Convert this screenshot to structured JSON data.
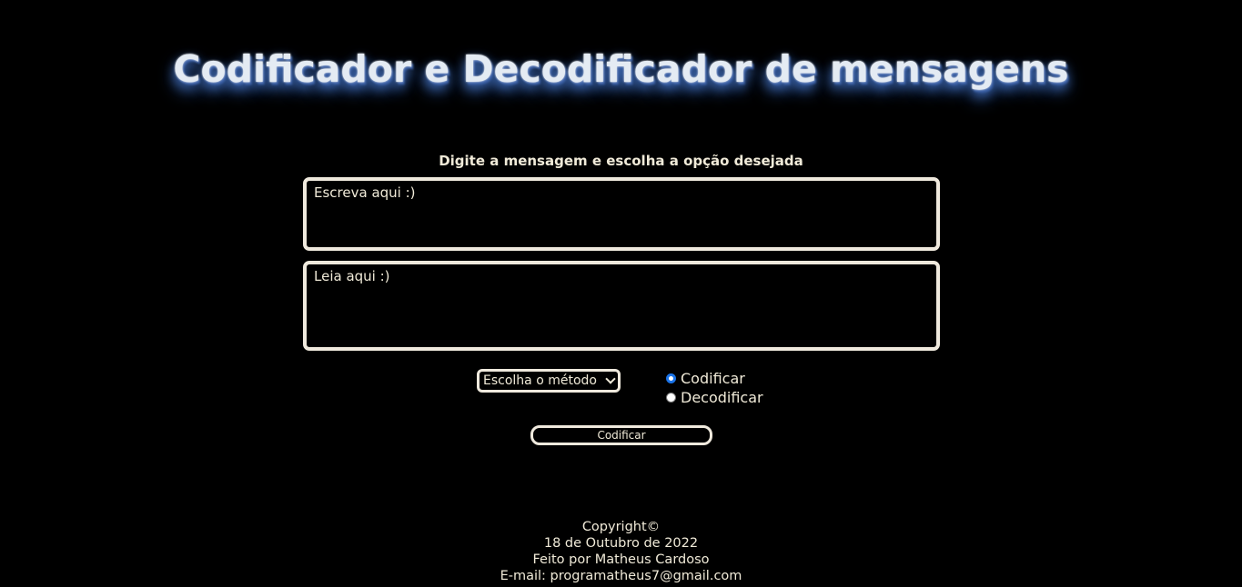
{
  "header": {
    "title": "Codificador e Decodificador de mensagens",
    "subtitle": "Digite a mensagem e escolha a opção desejada"
  },
  "form": {
    "input_placeholder": "Escreva aqui :)",
    "output_placeholder": "Leia aqui :)",
    "method_select": {
      "selected": "Escolha o método"
    },
    "radio_options": [
      {
        "label": "Codificar",
        "checked": true
      },
      {
        "label": "Decodificar",
        "checked": false
      }
    ],
    "action_button_label": "Codificar"
  },
  "footer": {
    "copyright": "Copyright©",
    "date": "18 de Outubro de 2022",
    "author": "Feito por Matheus Cardoso",
    "email": "E-mail: programatheus7@gmail.com"
  },
  "colors": {
    "background": "#000000",
    "text": "#f0ead8",
    "border": "#efe9dd",
    "title_glow": "#4a78c8",
    "radio_accent": "#1a73e8"
  }
}
